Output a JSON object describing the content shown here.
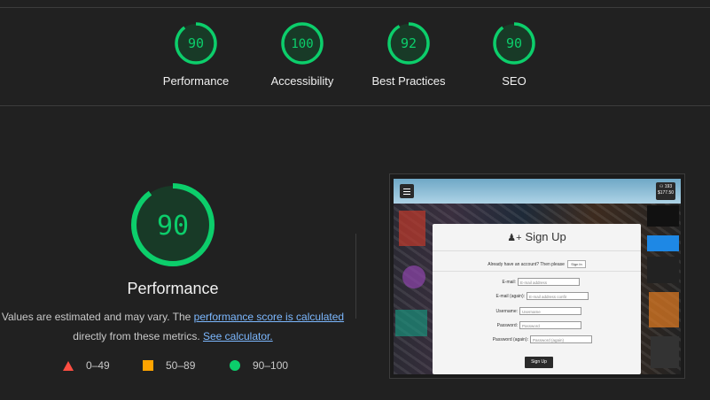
{
  "scores": [
    {
      "label": "Performance",
      "value": "90",
      "fraction": 0.9
    },
    {
      "label": "Accessibility",
      "value": "100",
      "fraction": 1.0
    },
    {
      "label": "Best Practices",
      "value": "92",
      "fraction": 0.92
    },
    {
      "label": "SEO",
      "value": "90",
      "fraction": 0.9
    }
  ],
  "colors": {
    "good": "#0cce6b",
    "average": "#ffa400",
    "poor": "#ff4e42"
  },
  "performance": {
    "score": "90",
    "fraction": 0.9,
    "title": "Performance",
    "desc_prefix": "Values are estimated and may vary. The ",
    "desc_link1": "performance score is calculated",
    "desc_middle": " directly from these metrics. ",
    "desc_link2": "See calculator."
  },
  "legend": [
    {
      "icon": "triangle-icon",
      "range": "0–49"
    },
    {
      "icon": "square-icon",
      "range": "50–89"
    },
    {
      "icon": "circle-icon",
      "range": "90–100"
    }
  ],
  "preview": {
    "stats_line1": "⚇ 193",
    "stats_line2": "$177.50",
    "title": "Sign Up",
    "already_text": "Already have an account? Then please",
    "already_button": "Sign In",
    "fields": [
      {
        "label": "E-mail:",
        "placeholder": "E-mail address"
      },
      {
        "label": "E-mail (again):",
        "placeholder": "E-mail address confir"
      },
      {
        "label": "Username:",
        "placeholder": "Username"
      },
      {
        "label": "Password:",
        "placeholder": "Password"
      },
      {
        "label": "Password (again):",
        "placeholder": "Password (again)"
      }
    ],
    "submit": "Sign Up"
  }
}
